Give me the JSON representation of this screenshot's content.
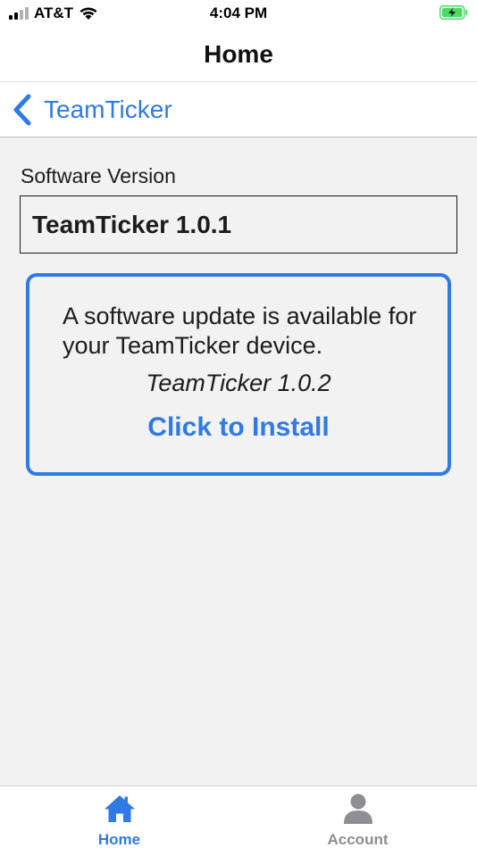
{
  "status_bar": {
    "carrier": "AT&T",
    "time": "4:04 PM",
    "battery_state": "charging"
  },
  "nav": {
    "title": "Home"
  },
  "back_nav": {
    "label": "TeamTicker"
  },
  "software": {
    "field_label": "Software Version",
    "current_version": "TeamTicker 1.0.1"
  },
  "update_card": {
    "message": "A software update is available for your TeamTicker device.",
    "new_version": "TeamTicker 1.0.2",
    "install_label": "Click to Install"
  },
  "tabs": [
    {
      "label": "Home",
      "icon": "home-icon",
      "active": true
    },
    {
      "label": "Account",
      "icon": "person-icon",
      "active": false
    }
  ],
  "colors": {
    "accent": "#2f7ae5",
    "inactive": "#8e8e93",
    "background": "#f2f2f2",
    "battery_green": "#4cd964"
  }
}
